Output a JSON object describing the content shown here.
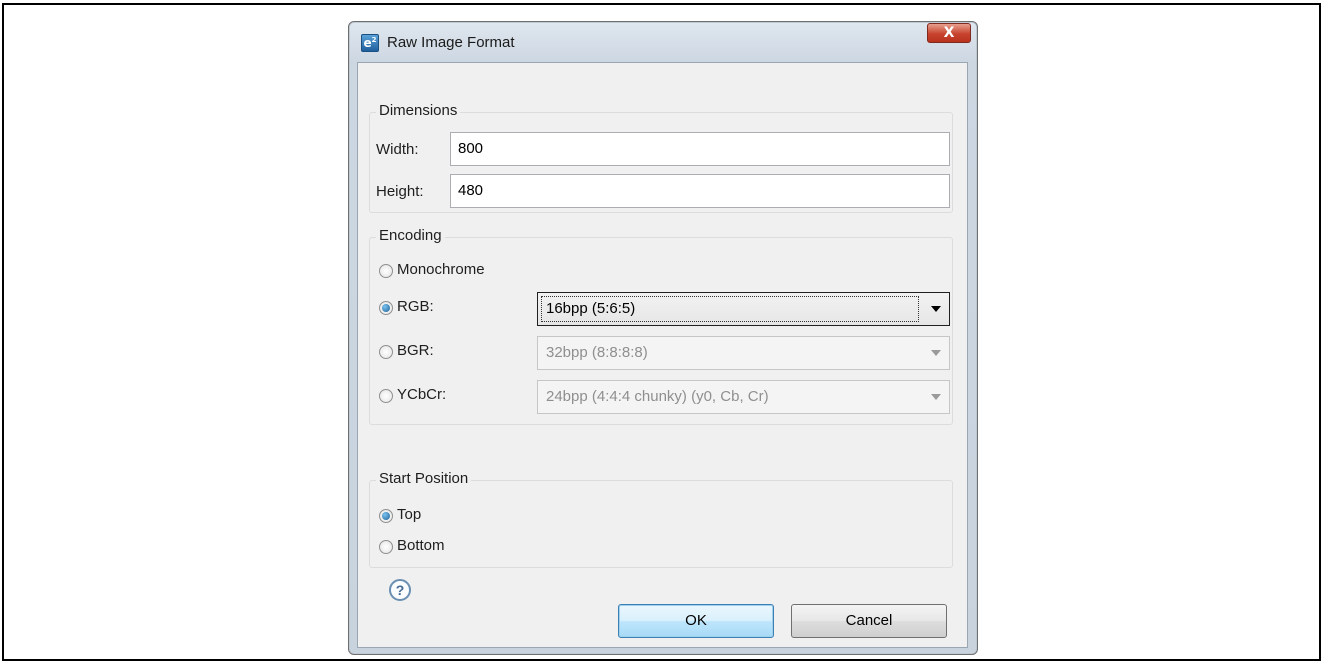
{
  "window": {
    "title": "Raw Image Format",
    "icon": "e2-app-icon",
    "close_label": "X"
  },
  "dimensions": {
    "legend": "Dimensions",
    "width_label": "Width:",
    "width_value": "800",
    "height_label": "Height:",
    "height_value": "480"
  },
  "encoding": {
    "legend": "Encoding",
    "options": [
      {
        "label": "Monochrome",
        "checked": false
      },
      {
        "label": "RGB:",
        "checked": true,
        "combo": "16bpp (5:6:5)",
        "enabled": true
      },
      {
        "label": "BGR:",
        "checked": false,
        "combo": "32bpp (8:8:8:8)",
        "enabled": false
      },
      {
        "label": "YCbCr:",
        "checked": false,
        "combo": "24bpp (4:4:4 chunky) (y0, Cb, Cr)",
        "enabled": false
      }
    ]
  },
  "start_position": {
    "legend": "Start Position",
    "options": [
      {
        "label": "Top",
        "checked": true
      },
      {
        "label": "Bottom",
        "checked": false
      }
    ]
  },
  "footer": {
    "help_label": "?",
    "ok_label": "OK",
    "cancel_label": "Cancel"
  },
  "colors": {
    "accent": "#3c7fb1",
    "close": "#c7432d",
    "dialog_bg": "#f0f0f0"
  }
}
